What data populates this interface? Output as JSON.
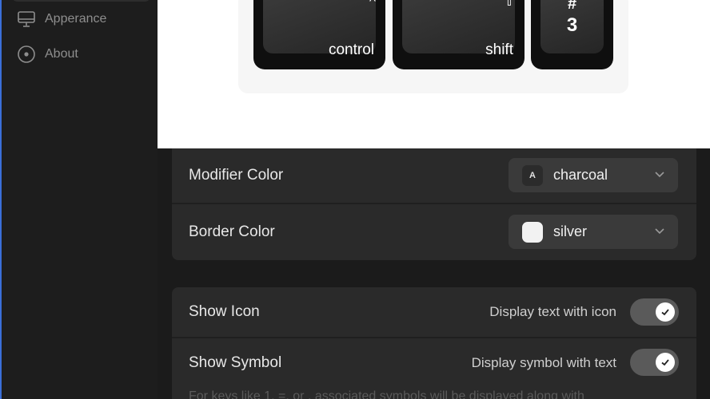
{
  "sidebar": {
    "items": [
      {
        "label": "Apperance",
        "icon": "monitor-icon"
      },
      {
        "label": "About",
        "icon": "info-circle-icon"
      }
    ]
  },
  "preview": {
    "keys": [
      {
        "symbol": "^",
        "label": "control"
      },
      {
        "symbol": "⇧",
        "label": "shift"
      },
      {
        "top": "#",
        "bottom": "3"
      }
    ]
  },
  "colors_card": {
    "modifier": {
      "title": "Modifier Color",
      "badge": "A",
      "value": "charcoal",
      "swatch": "#2b2b2b"
    },
    "border": {
      "title": "Border Color",
      "value": "silver",
      "swatch": "#f2f2f2"
    }
  },
  "display_card": {
    "show_icon": {
      "title": "Show Icon",
      "description": "Display text with icon",
      "enabled": true
    },
    "show_symbol": {
      "title": "Show Symbol",
      "description": "Display symbol with text",
      "enabled": true
    },
    "footnote": "For keys like 1, =, or , associated symbols will be displayed along with"
  },
  "theme": {
    "accent": "#3a6fd8",
    "card": "#2a2a2a",
    "toggle_track": "#5a5a5a"
  }
}
